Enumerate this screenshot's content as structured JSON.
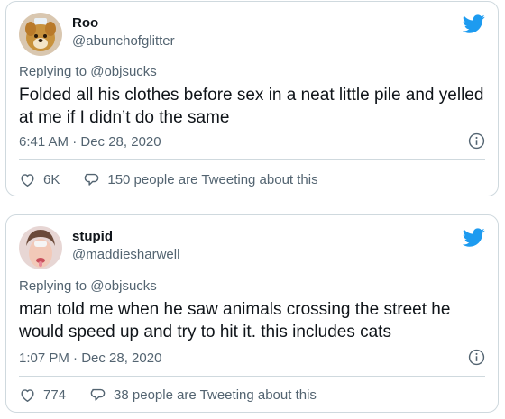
{
  "tweets": [
    {
      "name": "Roo",
      "handle": "@abunchofglitter",
      "replying_prefix": "Replying to ",
      "replying_to": "@objsucks",
      "text": "Folded all his clothes before sex in a neat little pile and yelled at me if I didn’t do the same",
      "timestamp": "6:41 AM · Dec 28, 2020",
      "likes": "6K",
      "tweeting": "150 people are Tweeting about this"
    },
    {
      "name": "stupid",
      "handle": "@maddiesharwell",
      "replying_prefix": "Replying to ",
      "replying_to": "@objsucks",
      "text": "man told me when he saw animals crossing the street he would speed up and try to hit it. this includes cats",
      "timestamp": "1:07 PM · Dec 28, 2020",
      "likes": "774",
      "tweeting": "38 people are Tweeting about this"
    }
  ],
  "icons": {
    "brand": "twitter-bird-icon",
    "info": "info-icon",
    "like": "heart-icon",
    "reply": "speech-bubble-icon"
  },
  "colors": {
    "brand_blue": "#1d9bf0",
    "secondary_text": "#536471",
    "border": "#cfd9de"
  }
}
